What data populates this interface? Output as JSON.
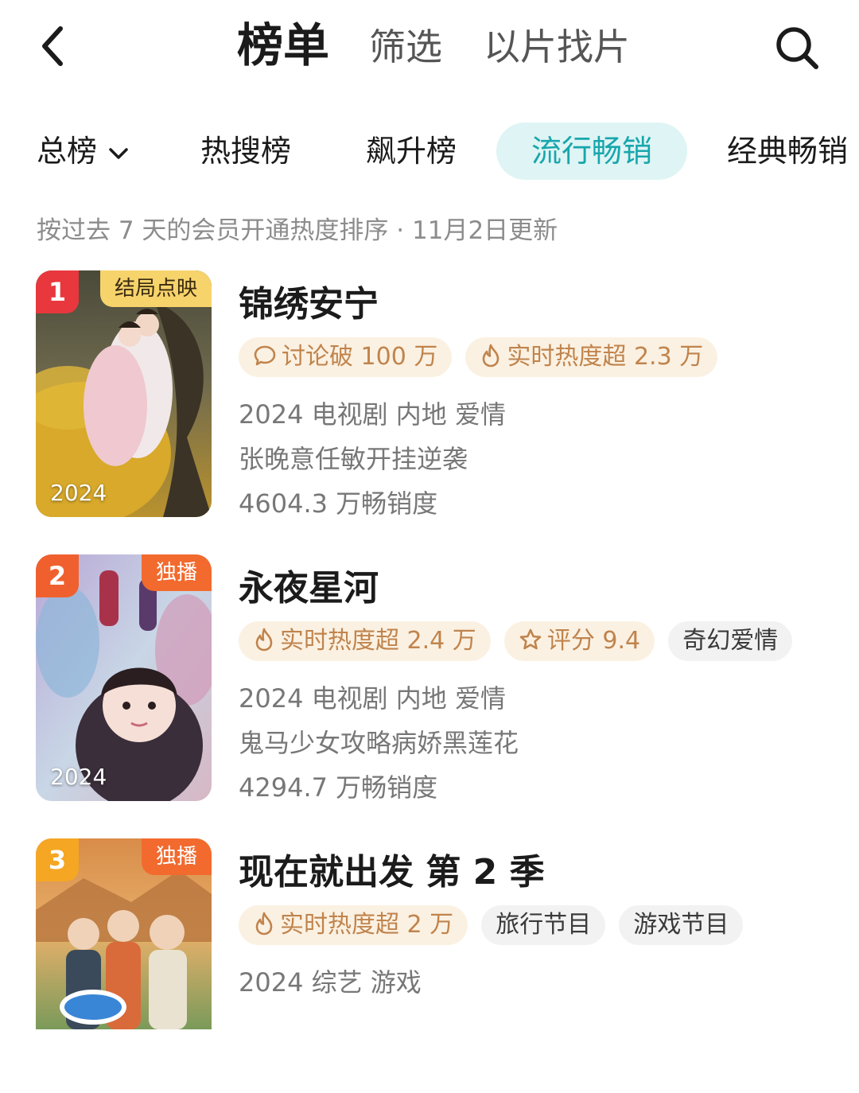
{
  "header": {
    "tabs": [
      {
        "label": "榜单",
        "active": true
      },
      {
        "label": "筛选",
        "active": false
      },
      {
        "label": "以片找片",
        "active": false
      }
    ],
    "back_icon": "chevron-left-icon",
    "search_icon": "search-icon"
  },
  "categories": [
    {
      "label": "总榜",
      "dropdown": true
    },
    {
      "label": "热搜榜"
    },
    {
      "label": "飙升榜"
    },
    {
      "label": "流行畅销",
      "active": true
    },
    {
      "label": "经典畅销"
    }
  ],
  "subtitle": "按过去 7 天的会员开通热度排序 · 11月2日更新",
  "colors": {
    "accent": "#18a6ad",
    "accent_bg": "#dff4f4",
    "hot_tag_bg": "#fbf1e2",
    "hot_tag_text": "#c0844d",
    "rank1": "#e8383d",
    "rank2": "#f0602e",
    "rank3": "#f5a623",
    "badge_yellow": "#f6d36b",
    "badge_orange": "#f26a2e"
  },
  "items": [
    {
      "rank": "1",
      "badge": "结局点映",
      "poster_year": "2024",
      "title": "锦绣安宁",
      "tags": [
        {
          "icon": "comment-icon",
          "text": "讨论破 100 万",
          "style": "hot"
        },
        {
          "icon": "flame-icon",
          "text": "实时热度超 2.3 万",
          "style": "hot"
        }
      ],
      "info": "2024 电视剧 内地 爱情",
      "description": "张晚意任敏开挂逆袭",
      "sales": "4604.3 万畅销度"
    },
    {
      "rank": "2",
      "badge": "独播",
      "poster_year": "2024",
      "title": "永夜星河",
      "tags": [
        {
          "icon": "flame-icon",
          "text": "实时热度超 2.4 万",
          "style": "hot"
        },
        {
          "icon": "star-icon",
          "text": "评分 9.4",
          "style": "hot"
        },
        {
          "icon": "",
          "text": "奇幻爱情",
          "style": "plain"
        }
      ],
      "info": "2024 电视剧 内地 爱情",
      "description": "鬼马少女攻略病娇黑莲花",
      "sales": "4294.7 万畅销度"
    },
    {
      "rank": "3",
      "badge": "独播",
      "poster_year": "",
      "title": "现在就出发 第 2 季",
      "tags": [
        {
          "icon": "flame-icon",
          "text": "实时热度超 2 万",
          "style": "hot"
        },
        {
          "icon": "",
          "text": "旅行节目",
          "style": "plain"
        },
        {
          "icon": "",
          "text": "游戏节目",
          "style": "plain"
        }
      ],
      "info": "2024 综艺 游戏"
    }
  ]
}
